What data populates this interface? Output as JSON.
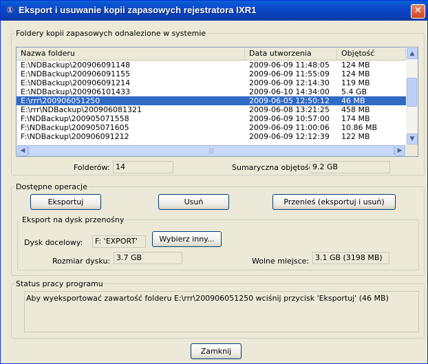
{
  "window": {
    "title": "Eksport i usuwanie kopii zapasowych rejestratora IXR1",
    "close_glyph": "✕",
    "app_icon_glyph": "①"
  },
  "folders_group": {
    "legend": "Foldery kopii zapasowych odnalezione w systemie",
    "columns": [
      "Nazwa folderu",
      "Data utworzenia",
      "Objętość"
    ],
    "rows": [
      {
        "name": "E:\\NDBackup\\200906091148",
        "date": "2009-06-09 11:48:05",
        "size": "124 MB",
        "selected": false
      },
      {
        "name": "E:\\NDBackup\\200906091155",
        "date": "2009-06-09 11:55:09",
        "size": "124 MB",
        "selected": false
      },
      {
        "name": "E:\\NDBackup\\200906091214",
        "date": "2009-06-09 12:14:30",
        "size": "119 MB",
        "selected": false
      },
      {
        "name": "E:\\NDBackup\\200906101433",
        "date": "2009-06-10 14:34:00",
        "size": "5.4 GB",
        "selected": false
      },
      {
        "name": "E:\\rrr\\200906051250",
        "date": "2009-06-05 12:50:12",
        "size": "46 MB",
        "selected": true
      },
      {
        "name": "E:\\rrr\\NDBackup\\200906081321",
        "date": "2009-06-08 13:21:25",
        "size": "458 MB",
        "selected": false
      },
      {
        "name": "F:\\NDBackup\\200905071558",
        "date": "2009-06-09 10:57:00",
        "size": "174 MB",
        "selected": false
      },
      {
        "name": "F:\\NDBackup\\200905071605",
        "date": "2009-06-09 11:00:06",
        "size": "10.86 MB",
        "selected": false
      },
      {
        "name": "F:\\NDBackup\\200906091212",
        "date": "2009-06-09 12:12:39",
        "size": "122 MB",
        "selected": false
      }
    ],
    "folders_label": "Folderów:",
    "folders_count": "14",
    "total_size_label": "Sumaryczna objętość:",
    "total_size": "9.2 GB"
  },
  "operations_group": {
    "legend": "Dostępne operacje",
    "export_button": "Eksportuj",
    "delete_button": "Usuń",
    "move_button": "Przenieś (eksportuj i usuń)",
    "removable_group": {
      "legend": "Eksport na dysk przenośny",
      "target_label": "Dysk docelowy:",
      "target_value": "F: 'EXPORT'",
      "choose_button": "Wybierz inny...",
      "disk_size_label": "Rozmiar dysku:",
      "disk_size": "3.7 GB",
      "free_label": "Wolne miejsce:",
      "free_value": "3.1 GB (3198 MB)"
    }
  },
  "status_group": {
    "legend": "Status pracy programu",
    "message": "Aby wyeksportować zawartość folderu E:\\rrr\\200906051250 wciśnij przycisk 'Eksportuj' (46 MB)"
  },
  "footer": {
    "close_button": "Zamknij"
  },
  "scroll_glyphs": {
    "up": "▲",
    "down": "▼",
    "left": "◀",
    "right": "▶",
    "grip": "|||"
  }
}
